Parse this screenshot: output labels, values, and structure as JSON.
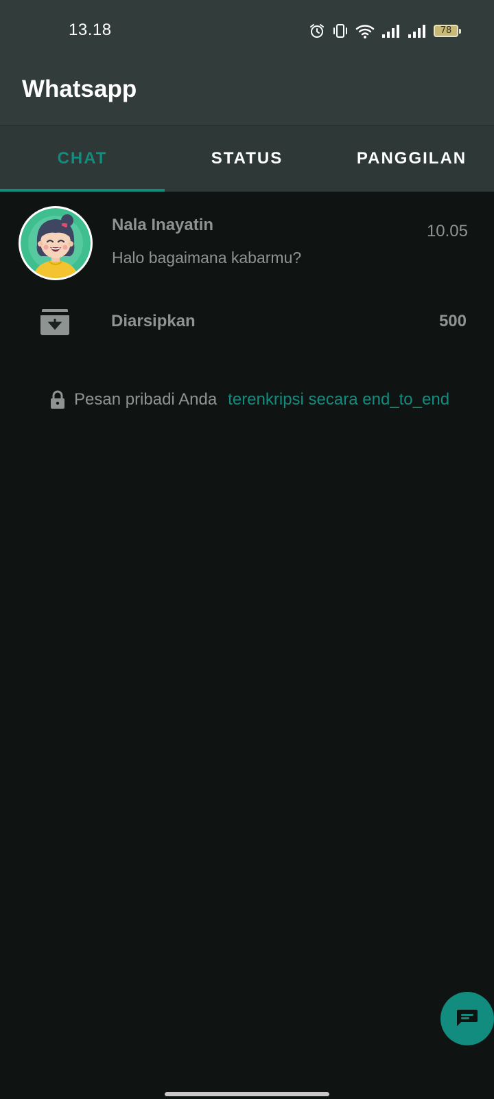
{
  "status_bar": {
    "time": "13.18",
    "battery_level": "78",
    "icons": [
      "alarm-icon",
      "vibrate-icon",
      "wifi-icon",
      "signal-icon",
      "signal-icon",
      "battery-icon"
    ]
  },
  "app": {
    "title": "Whatsapp"
  },
  "tabs": [
    {
      "label": "CHAT",
      "active": true
    },
    {
      "label": "STATUS",
      "active": false
    },
    {
      "label": "PANGGILAN",
      "active": false
    }
  ],
  "chats": [
    {
      "name": "Nala Inayatin",
      "message": "Halo bagaimana kabarmu?",
      "time": "10.05"
    }
  ],
  "archived": {
    "label": "Diarsipkan",
    "count": "500"
  },
  "encryption": {
    "text": "Pesan pribadi Anda",
    "link": "terenkripsi secara end_to_end"
  },
  "fab": {
    "icon": "new-chat-icon"
  },
  "colors": {
    "accent": "#128c7e",
    "header": "#323c3b",
    "background": "#0f1312",
    "muted_text": "#8f9493"
  }
}
